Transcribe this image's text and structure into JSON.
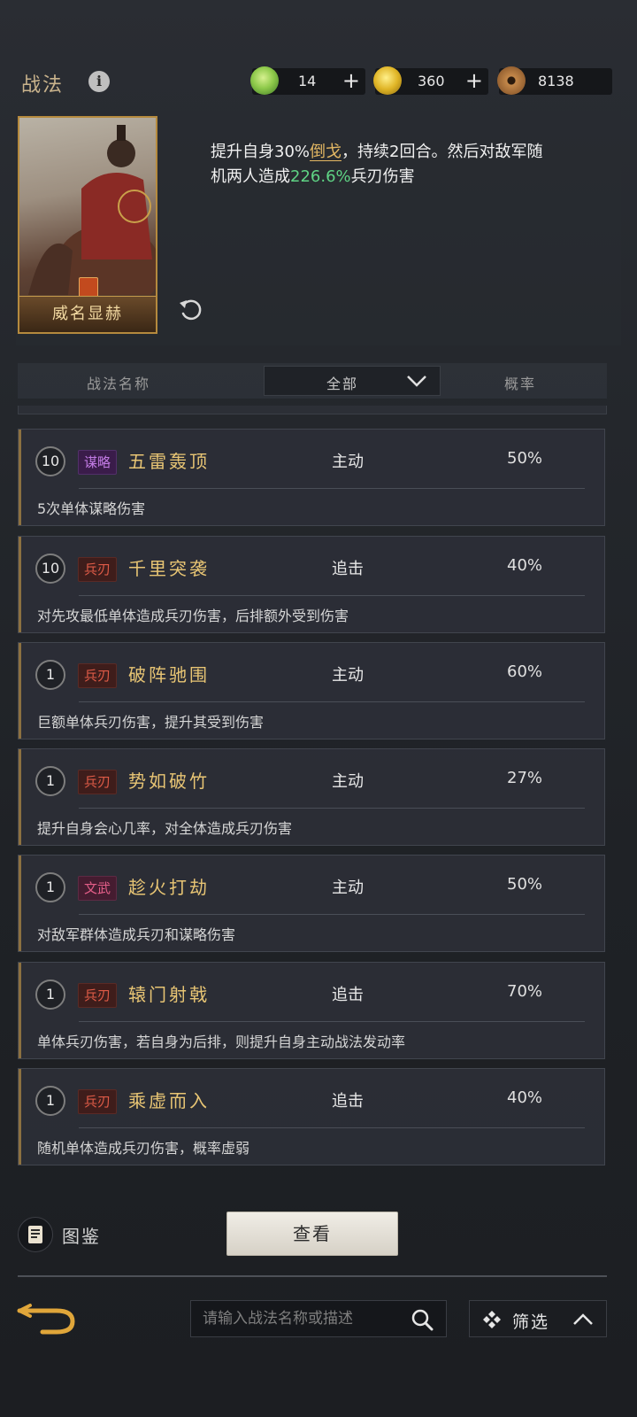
{
  "header": {
    "title": "战法",
    "info_icon": "info-icon",
    "currencies": [
      {
        "name": "jade",
        "icon": "jade-coin-icon",
        "value": "14",
        "color": "#7fc14a"
      },
      {
        "name": "gold",
        "icon": "gold-coin-icon",
        "value": "360",
        "color": "#e0b526"
      },
      {
        "name": "copper",
        "icon": "copper-coin-icon",
        "value": "8138",
        "color": "#a06a33"
      }
    ],
    "plus": "+"
  },
  "hero": {
    "name": "威名显赫",
    "desc_parts": [
      "提升自身30%",
      "倒戈",
      "，持续2回合。然后对敌军随机两人造成",
      "226.6%",
      "兵刃伤害"
    ]
  },
  "filter": {
    "col_name": "战法名称",
    "type_selected": "全部",
    "col_rate": "概率"
  },
  "items": [
    {
      "level": "10",
      "tag": "谋略",
      "tag_color": "purple",
      "name": "五雷轰顶",
      "type": "主动",
      "rate": "50%",
      "desc": "5次单体谋略伤害"
    },
    {
      "level": "10",
      "tag": "兵刃",
      "tag_color": "red",
      "name": "千里突袭",
      "type": "追击",
      "rate": "40%",
      "desc": "对先攻最低单体造成兵刃伤害，后排额外受到伤害"
    },
    {
      "level": "1",
      "tag": "兵刃",
      "tag_color": "red",
      "name": "破阵驰围",
      "type": "主动",
      "rate": "60%",
      "desc": "巨额单体兵刃伤害，提升其受到伤害"
    },
    {
      "level": "1",
      "tag": "兵刃",
      "tag_color": "red",
      "name": "势如破竹",
      "type": "主动",
      "rate": "27%",
      "desc": "提升自身会心几率，对全体造成兵刃伤害"
    },
    {
      "level": "1",
      "tag": "文武",
      "tag_color": "pink",
      "name": "趁火打劫",
      "type": "主动",
      "rate": "50%",
      "desc": "对敌军群体造成兵刃和谋略伤害"
    },
    {
      "level": "1",
      "tag": "兵刃",
      "tag_color": "red",
      "name": "辕门射戟",
      "type": "追击",
      "rate": "70%",
      "desc": "单体兵刃伤害，若自身为后排，则提升自身主动战法发动率"
    },
    {
      "level": "1",
      "tag": "兵刃",
      "tag_color": "red",
      "name": "乘虚而入",
      "type": "追击",
      "rate": "40%",
      "desc": "随机单体造成兵刃伤害，概率虚弱"
    }
  ],
  "bottom": {
    "atlas_label": "图鉴",
    "view_button": "查看",
    "search_placeholder": "请输入战法名称或描述",
    "filter_label": "筛选"
  }
}
